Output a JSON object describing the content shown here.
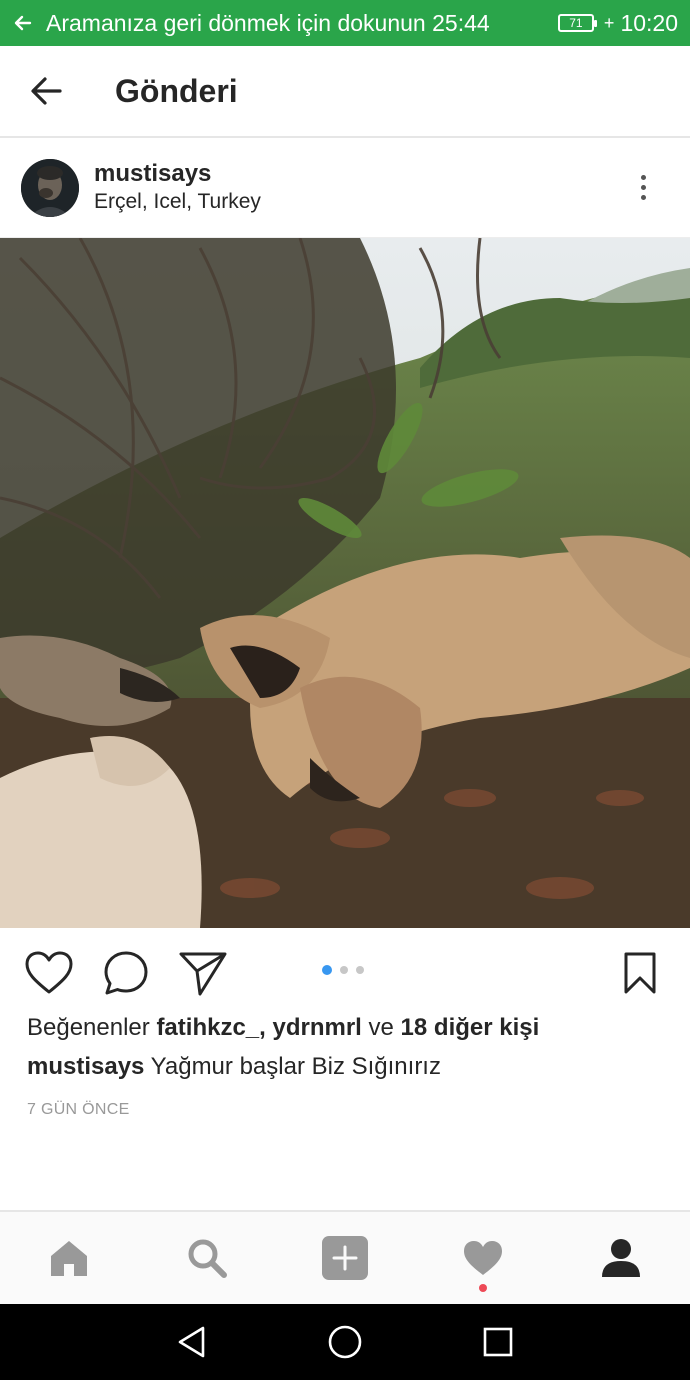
{
  "status_bar": {
    "return_text": "Aramanıza geri dönmek için dokunun",
    "call_timer": "25:44",
    "battery_level": "71",
    "clock": "10:20",
    "background_color": "#2aa54a"
  },
  "header": {
    "title": "Gönderi",
    "back_icon": "arrow-left-icon"
  },
  "post": {
    "username": "mustisays",
    "location": "Erçel, Icel, Turkey",
    "more_icon": "more-vertical-icon",
    "photo_description_icon": "post-photo",
    "carousel": {
      "count": 3,
      "active_index": 0,
      "active_color": "#3897f0"
    },
    "actions": {
      "like_icon": "heart-outline-icon",
      "comment_icon": "comment-icon",
      "share_icon": "paper-plane-icon",
      "save_icon": "bookmark-icon"
    },
    "likes": {
      "prefix": "Beğenenler",
      "users": "fatihkzc_, ydrnmrl",
      "connector": "ve",
      "others": "18 diğer kişi"
    },
    "caption": {
      "author": "mustisays",
      "text": "Yağmur başlar Biz Sığınırız"
    },
    "timestamp": "7 GÜN ÖNCE"
  },
  "tab_bar": {
    "items": [
      {
        "icon": "home-icon",
        "active": false
      },
      {
        "icon": "search-icon",
        "active": false
      },
      {
        "icon": "add-post-icon",
        "active": false
      },
      {
        "icon": "heart-icon",
        "active": false,
        "has_notification": true
      },
      {
        "icon": "profile-icon",
        "active": true
      }
    ],
    "notification_color": "#ed4956"
  },
  "nav_bar": {
    "items": [
      "back-triangle-icon",
      "home-circle-icon",
      "recents-square-icon"
    ]
  }
}
